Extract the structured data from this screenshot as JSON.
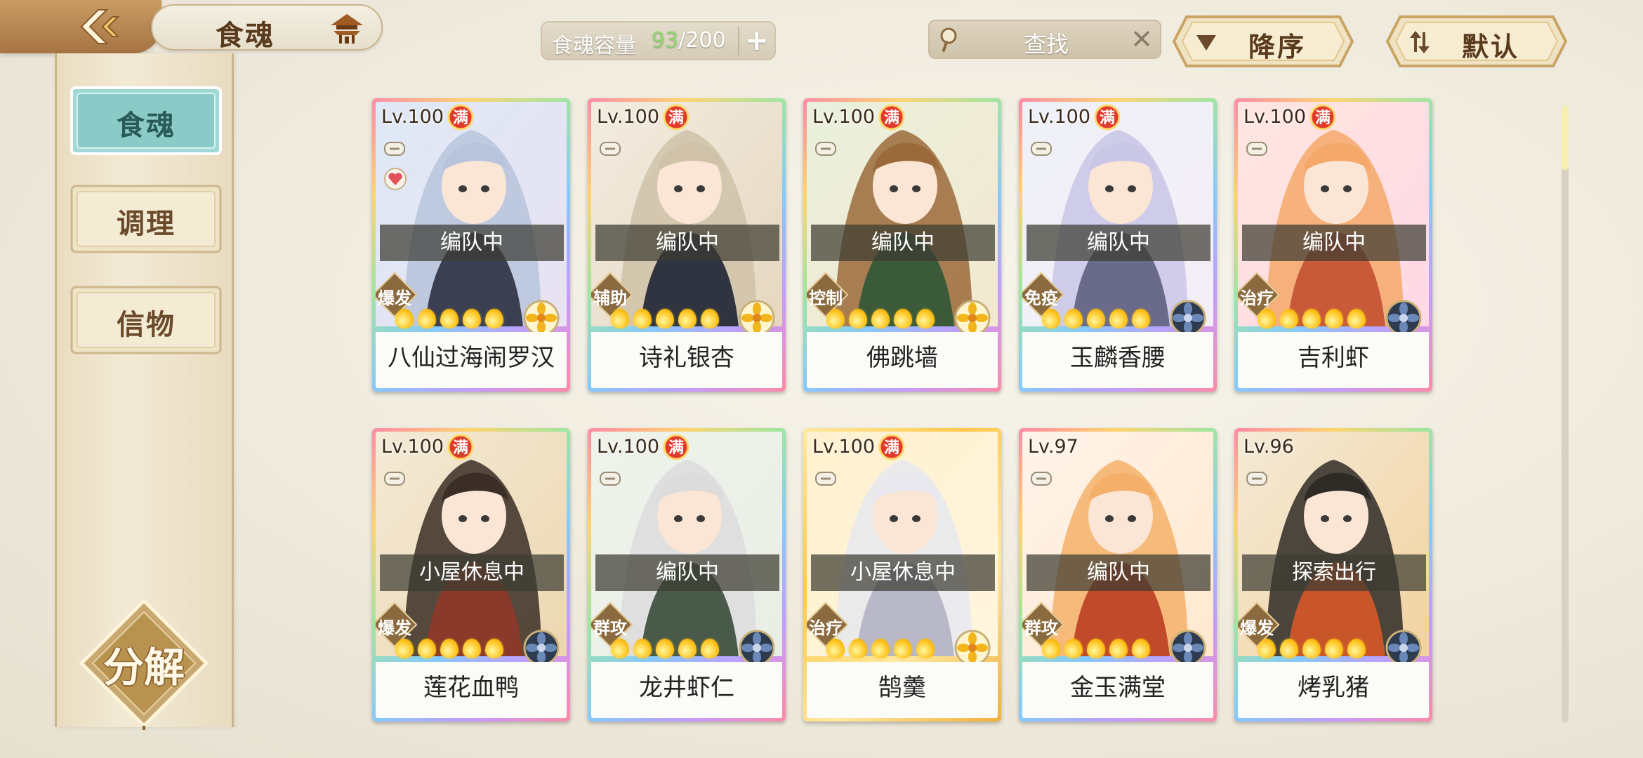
{
  "header": {
    "title": "食魂",
    "capacity_label": "食魂容量",
    "capacity_current": "93",
    "capacity_max": "/200",
    "plus_label": "+",
    "search_placeholder": "查找",
    "clear_label": "✕",
    "sort_order_label": "降序",
    "sort_mode_label": "默认"
  },
  "sidebar": {
    "items": [
      {
        "label": "食魂",
        "active": true
      },
      {
        "label": "调理",
        "active": false
      },
      {
        "label": "信物",
        "active": false
      }
    ],
    "decompose_label": "分解"
  },
  "colors": {
    "accent_brown": "#a77443",
    "active_tab": "#8fd0cf",
    "capacity_current": "#8fd96a"
  },
  "cards": [
    {
      "level": "Lv.100",
      "max": "满",
      "status": "编队中",
      "role": "爆发",
      "name": "八仙过海闹罗汉",
      "stars": 5,
      "heart": true,
      "emblem": "gold-flower",
      "frame": "rainbow"
    },
    {
      "level": "Lv.100",
      "max": "满",
      "status": "编队中",
      "role": "辅助",
      "name": "诗礼银杏",
      "stars": 5,
      "heart": false,
      "emblem": "gold-flower",
      "frame": "rainbow"
    },
    {
      "level": "Lv.100",
      "max": "满",
      "status": "编队中",
      "role": "控制",
      "name": "佛跳墙",
      "stars": 5,
      "heart": false,
      "emblem": "gold-flower",
      "frame": "rainbow"
    },
    {
      "level": "Lv.100",
      "max": "满",
      "status": "编队中",
      "role": "免疫",
      "name": "玉麟香腰",
      "stars": 5,
      "heart": false,
      "emblem": "dark-flower",
      "frame": "rainbow"
    },
    {
      "level": "Lv.100",
      "max": "满",
      "status": "编队中",
      "role": "治疗",
      "name": "吉利虾",
      "stars": 5,
      "heart": false,
      "emblem": "dark-flower",
      "frame": "rainbow"
    },
    {
      "level": "Lv.100",
      "max": "满",
      "status": "小屋休息中",
      "role": "爆发",
      "name": "莲花血鸭",
      "stars": 5,
      "heart": false,
      "emblem": "dark-flower",
      "frame": "rainbow"
    },
    {
      "level": "Lv.100",
      "max": "满",
      "status": "编队中",
      "role": "群攻",
      "name": "龙井虾仁",
      "stars": 5,
      "heart": false,
      "emblem": "dark-flower",
      "frame": "rainbow"
    },
    {
      "level": "Lv.100",
      "max": "满",
      "status": "小屋休息中",
      "role": "治疗",
      "name": "鹄羹",
      "stars": 5,
      "heart": false,
      "emblem": "gold-flower",
      "frame": "gold"
    },
    {
      "level": "Lv.97",
      "max": "",
      "status": "编队中",
      "role": "群攻",
      "name": "金玉满堂",
      "stars": 5,
      "heart": false,
      "emblem": "dark-flower",
      "frame": "rainbow"
    },
    {
      "level": "Lv.96",
      "max": "",
      "status": "探索出行",
      "role": "爆发",
      "name": "烤乳猪",
      "stars": 5,
      "heart": false,
      "emblem": "dark-flower",
      "frame": "rainbow"
    }
  ]
}
